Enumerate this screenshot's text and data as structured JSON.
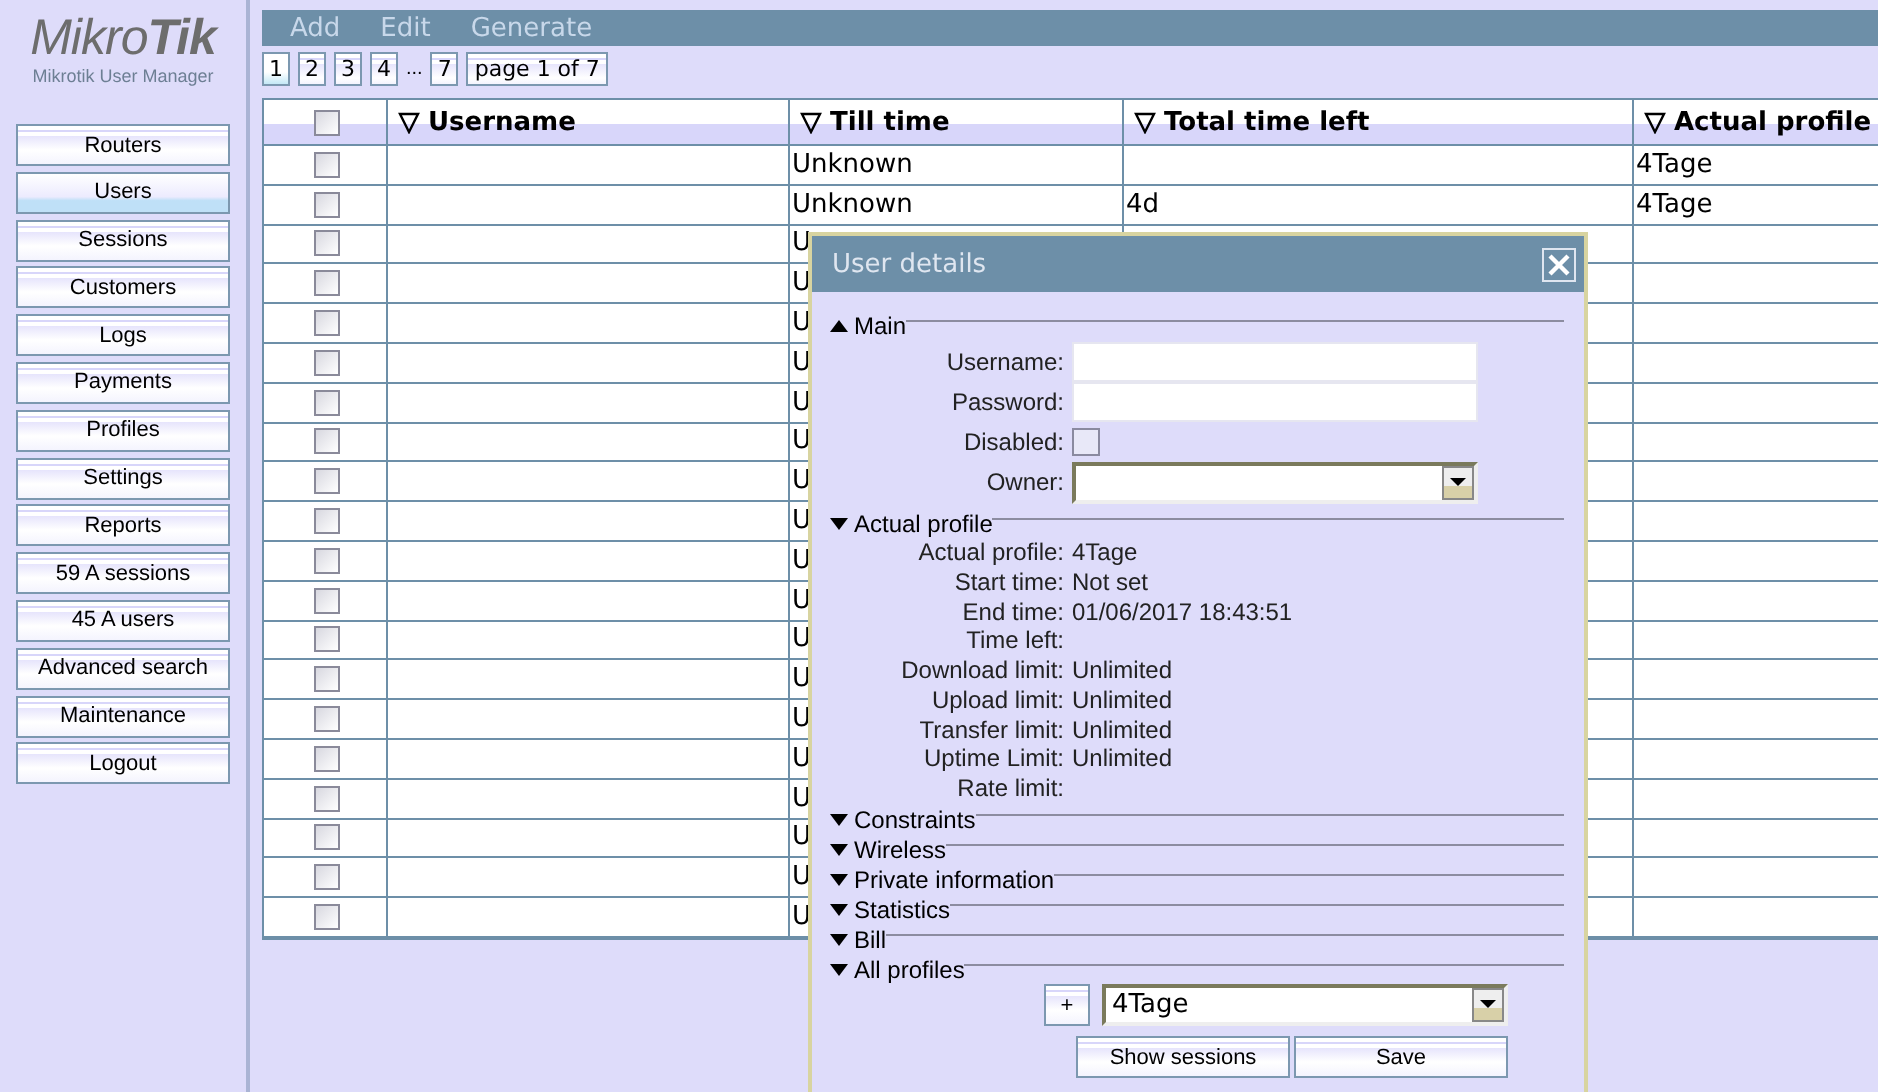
{
  "app": {
    "logo": "Mikro**Tik**",
    "subtitle": "Mikrotik User Manager"
  },
  "nav": [
    {
      "label": "Routers",
      "selected": false
    },
    {
      "label": "Users",
      "selected": true
    },
    {
      "label": "Sessions",
      "selected": false
    },
    {
      "label": "Customers",
      "selected": false
    },
    {
      "label": "Logs",
      "selected": false
    },
    {
      "label": "Payments",
      "selected": false
    },
    {
      "label": "Profiles",
      "selected": false
    },
    {
      "label": "Settings",
      "selected": false
    },
    {
      "label": "Reports",
      "selected": false
    },
    {
      "label": "59 A sessions",
      "selected": false
    },
    {
      "label": "45 A users",
      "selected": false
    },
    {
      "label": "Advanced search",
      "selected": false
    },
    {
      "label": "Maintenance",
      "selected": false
    },
    {
      "label": "Logout",
      "selected": false
    }
  ],
  "toolbar": [
    "Add",
    "Edit",
    "Generate"
  ],
  "pagination": {
    "pages": [
      {
        "label": "1",
        "selected": true
      },
      {
        "label": "2",
        "selected": false
      },
      {
        "label": "3",
        "selected": false
      },
      {
        "label": "4",
        "selected": false
      },
      {
        "label": "...",
        "kind": "gap"
      },
      {
        "label": "7",
        "selected": false
      }
    ],
    "summary": "page 1 of 7"
  },
  "table": {
    "header_checked": false,
    "columns": [
      "Username",
      "Till time",
      "Total time left",
      "Actual profile"
    ],
    "rows": [
      {
        "checked": false,
        "till_time": "Unknown",
        "actual_profile": "4Tage"
      },
      {
        "checked": false,
        "till_time": "Unknown",
        "total_time_left": "4d",
        "actual_profile": "4Tage"
      },
      {
        "checked": false,
        "till_time": "U"
      },
      {
        "checked": false,
        "till_time": "U"
      },
      {
        "checked": false,
        "till_time": "U"
      },
      {
        "checked": false,
        "till_time": "U"
      },
      {
        "checked": false,
        "till_time": "U"
      },
      {
        "checked": false,
        "till_time": "U"
      },
      {
        "checked": false,
        "till_time": "U"
      },
      {
        "checked": false,
        "till_time": "U"
      },
      {
        "checked": false,
        "till_time": "U"
      },
      {
        "checked": false,
        "till_time": "U"
      },
      {
        "checked": false,
        "till_time": "U"
      },
      {
        "checked": false,
        "till_time": "U"
      },
      {
        "checked": false,
        "till_time": "U"
      },
      {
        "checked": false,
        "till_time": "U"
      },
      {
        "checked": false,
        "till_time": "U"
      },
      {
        "checked": false,
        "till_time": "U"
      },
      {
        "checked": false,
        "till_time": "U"
      },
      {
        "checked": false,
        "till_time": "U"
      }
    ]
  },
  "dialog": {
    "title": "User details",
    "sections": [
      {
        "title": "Main",
        "pointing_up": true,
        "fields": [
          {
            "label": "Username:",
            "kind": "text"
          },
          {
            "label": "Password:",
            "kind": "password"
          },
          {
            "label": "Disabled:",
            "kind": "checkbox",
            "checked": false
          },
          {
            "label": "Owner:",
            "kind": "select"
          }
        ]
      },
      {
        "title": "Actual profile",
        "pointing_up": false,
        "info": [
          {
            "label": "Actual profile:",
            "value": "4Tage"
          },
          {
            "label": "Start time:",
            "value": "Not set"
          },
          {
            "label": "End time:",
            "value": "01/06/2017 18:43:51"
          },
          {
            "label": "Time left:"
          },
          {
            "label": "Download limit:",
            "value": "Unlimited"
          },
          {
            "label": "Upload limit:",
            "value": "Unlimited"
          },
          {
            "label": "Transfer limit:",
            "value": "Unlimited"
          },
          {
            "label": "Uptime Limit:",
            "value": "Unlimited"
          },
          {
            "label": "Rate limit:"
          }
        ]
      },
      {
        "title": "Constraints",
        "pointing_up": false
      },
      {
        "title": "Wireless",
        "pointing_up": false
      },
      {
        "title": "Private information",
        "pointing_up": false
      },
      {
        "title": "Statistics",
        "pointing_up": false
      },
      {
        "title": "Bill",
        "pointing_up": false
      },
      {
        "title": "All profiles",
        "pointing_up": false
      }
    ],
    "add_button": "+",
    "profile": "4Tage",
    "buttons": [
      "Show sessions",
      "Save"
    ]
  }
}
